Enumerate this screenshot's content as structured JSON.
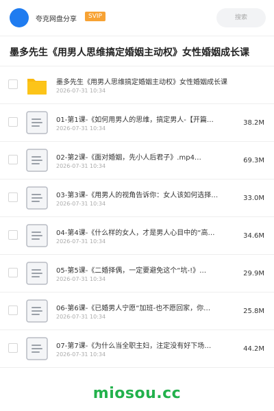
{
  "header": {
    "share_title": "夸克网盘分享",
    "badge": "SVIP",
    "search_placeholder": "搜索"
  },
  "page_title": "墨多先生《用男人思维搞定婚姻主动权》女性婚姻成长课",
  "files": [
    {
      "type": "folder",
      "name": "墨多先生《用男人思维搞定婚姻主动权》女性婚姻成长课",
      "date": "2026-07-31 10:34",
      "size": ""
    },
    {
      "type": "file",
      "name": "01-第1课-《如何用男人的思维，搞定男人-【开篇…",
      "date": "2026-07-31 10:34",
      "size": "38.2M"
    },
    {
      "type": "file",
      "name": "02-第2课-《面对婚姻，先小人后君子》.mp4…",
      "date": "2026-07-31 10:34",
      "size": "69.3M"
    },
    {
      "type": "file",
      "name": "03-第3课-《用男人的视角告诉你：女人该如何选择…",
      "date": "2026-07-31 10:34",
      "size": "33.0M"
    },
    {
      "type": "file",
      "name": "04-第4课-《什么样的女人，才是男人心目中的“高…",
      "date": "2026-07-31 10:34",
      "size": "34.6M"
    },
    {
      "type": "file",
      "name": "05-第5课-《二婚择偶，一定要避免这个“坑-!》…",
      "date": "2026-07-31 10:34",
      "size": "29.9M"
    },
    {
      "type": "file",
      "name": "06-第6课-《已婚男人宁愿“加班-也不愿回家，你…",
      "date": "2026-07-31 10:34",
      "size": "25.8M"
    },
    {
      "type": "file",
      "name": "07-第7课-《为什么当全职主妇，注定没有好下场…",
      "date": "2026-07-31 10:34",
      "size": "44.2M"
    }
  ],
  "watermark": "miosou.cc",
  "colors": {
    "avatar": "#1f7cf0",
    "badge": "#f7a234",
    "folder": "#fcc419",
    "watermark": "#22b14c"
  },
  "icons": {
    "folder": "folder-icon",
    "file": "document-icon"
  }
}
